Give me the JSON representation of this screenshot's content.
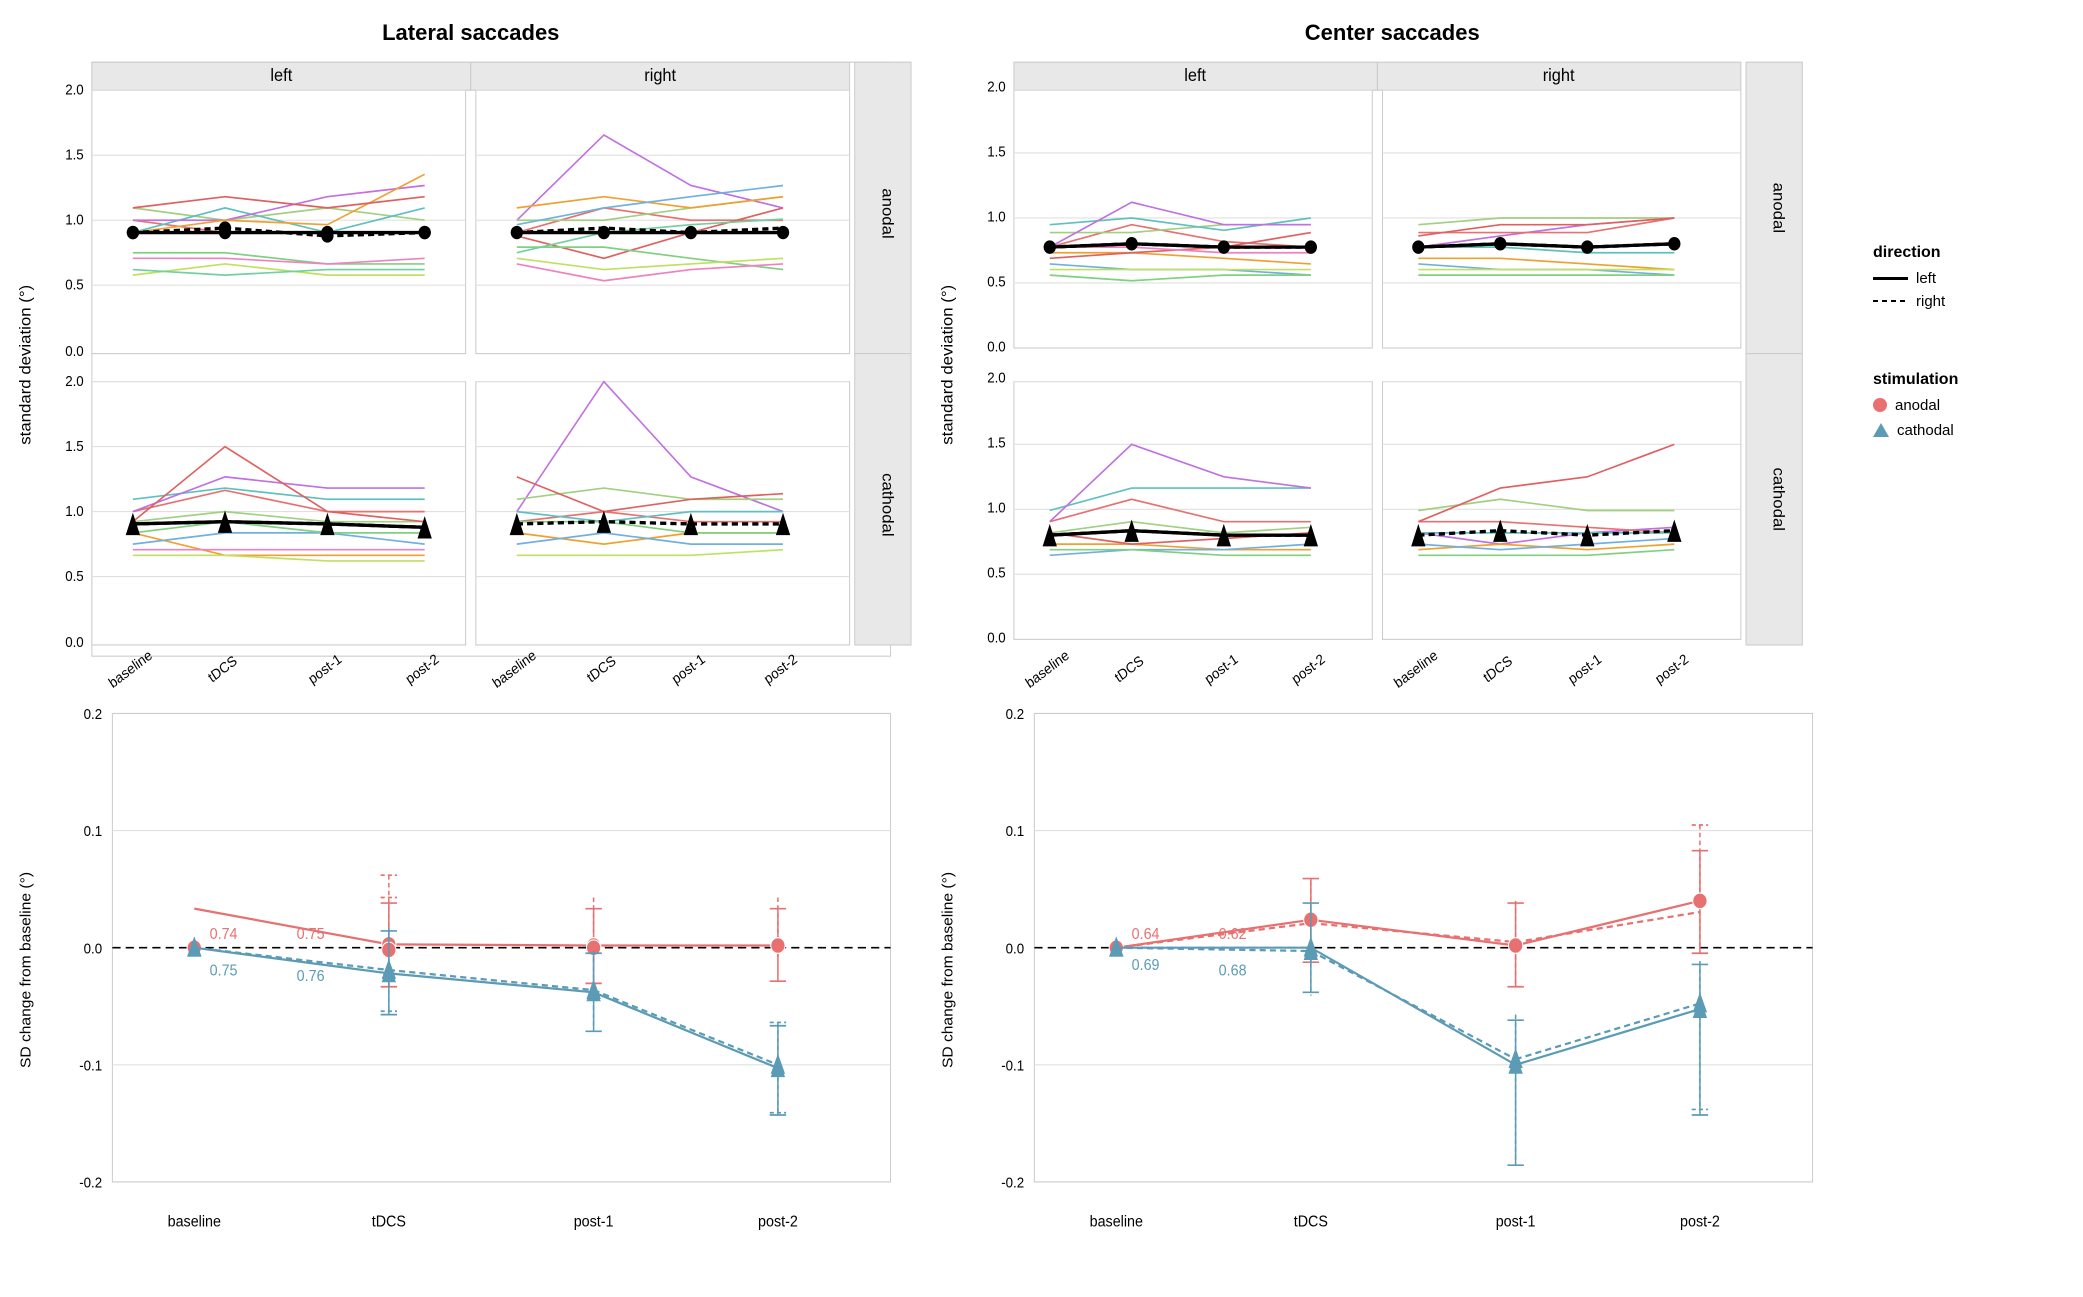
{
  "titles": {
    "lateral": "Lateral saccades",
    "center": "Center saccades"
  },
  "facet_labels": {
    "left": "left",
    "right": "right",
    "anodal": "anodal",
    "cathodal": "cathodal"
  },
  "x_labels": [
    "baseline",
    "tDCS",
    "post-1",
    "post-2"
  ],
  "y_label_top": "standard deviation (°)",
  "y_label_bottom": "SD change from baseline (°)",
  "legend_direction": {
    "title": "direction",
    "solid": "left",
    "dashed": "right"
  },
  "legend_stimulation": {
    "title": "stimulation",
    "anodal": "anodal",
    "cathodal": "cathodal",
    "anodal_color": "#e87070",
    "cathodal_color": "#5b9bb5"
  },
  "bottom_values": {
    "lateral": {
      "anodal_baseline": "0.74",
      "anodal_tdcs": "0.75",
      "cathodal_baseline": "0.75",
      "cathodal_tdcs": "0.76"
    },
    "center": {
      "anodal_baseline": "0.64",
      "anodal_tdcs": "0.62",
      "cathodal_baseline": "0.69",
      "cathodal_tdcs": "0.68"
    }
  }
}
